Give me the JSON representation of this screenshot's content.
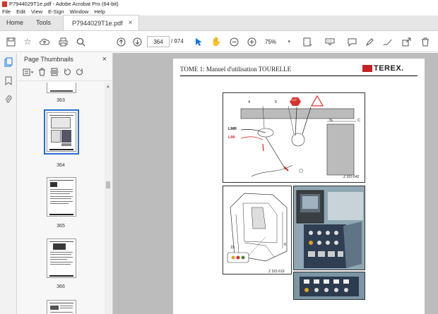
{
  "window": {
    "title": "P7944029T1e.pdf - Adobe Acrobat Pro (64-bit)"
  },
  "menu": [
    "File",
    "Edit",
    "View",
    "E-Sign",
    "Window",
    "Help"
  ],
  "tabs": {
    "home": "Home",
    "tools": "Tools",
    "document": "P7944029T1e.pdf"
  },
  "toolbar": {
    "current_page": "364",
    "page_count": "/ 974",
    "zoom": "75%"
  },
  "panel": {
    "title": "Page Thumbnails"
  },
  "thumbnails": [
    {
      "label": "363"
    },
    {
      "label": "364"
    },
    {
      "label": "365"
    },
    {
      "label": "366"
    }
  ],
  "document": {
    "header_title": "TOME 1: Manuel d'utilisation TOURELLE",
    "logo_text": "TEREX.",
    "figure1": {
      "labels": [
        "4",
        "5",
        "%",
        "C",
        "LMR",
        "LMI"
      ],
      "code": "Z 315 642",
      "stop": "STOP"
    },
    "figure2": {
      "labels": [
        "6",
        "15"
      ],
      "code": "Z 315 619"
    }
  },
  "colors": {
    "accent": "#1473e6",
    "brand_red": "#c62127",
    "viewer_bg": "#bcbcbc"
  }
}
